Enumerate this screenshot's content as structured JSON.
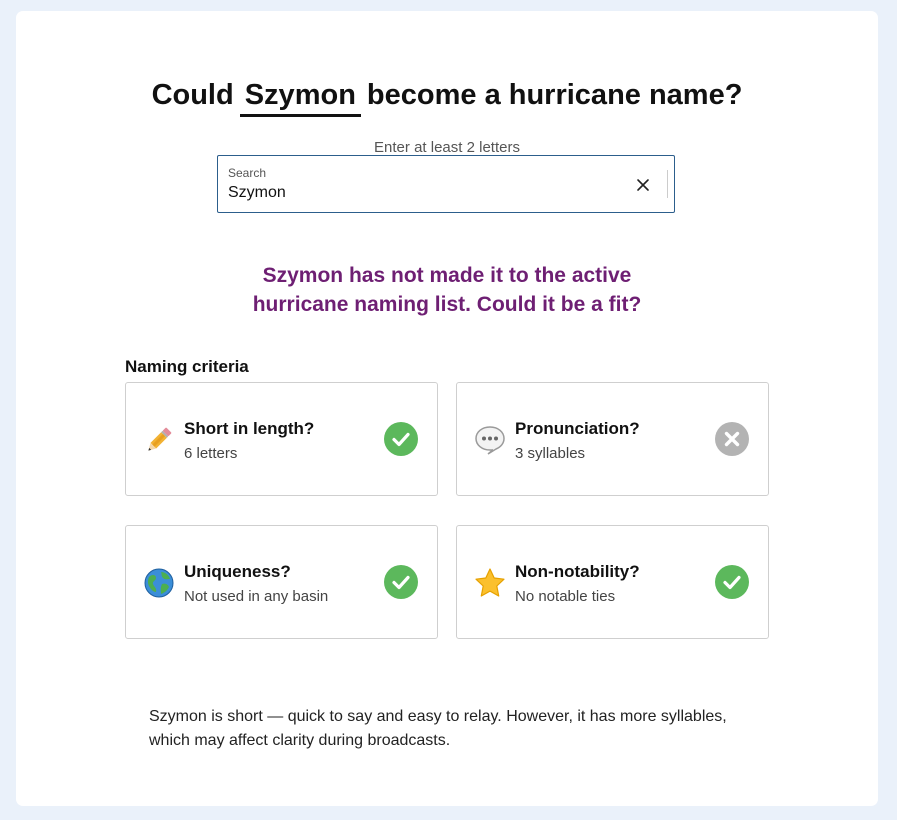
{
  "headline": {
    "prefix": "Could",
    "name": "Szymon",
    "suffix": "become a hurricane name?"
  },
  "search": {
    "hint": "Enter at least 2 letters",
    "label": "Search",
    "value": "Szymon"
  },
  "result_message": {
    "line1": "Szymon has not made it to the active",
    "line2": "hurricane naming list. Could it be a fit?"
  },
  "criteria": {
    "heading": "Naming criteria",
    "items": [
      {
        "icon": "pencil-icon",
        "title": "Short in length?",
        "detail": "6 letters",
        "status": "pass"
      },
      {
        "icon": "speech-bubble-icon",
        "title": "Pronunciation?",
        "detail": "3 syllables",
        "status": "fail"
      },
      {
        "icon": "globe-icon",
        "title": "Uniqueness?",
        "detail": "Not used in any basin",
        "status": "pass"
      },
      {
        "icon": "star-icon",
        "title": "Non-notability?",
        "detail": "No notable ties",
        "status": "pass"
      }
    ]
  },
  "summary": "Szymon is short — quick to say and easy to relay. However, it has more syllables, which may affect clarity during broadcasts.",
  "colors": {
    "result_text": "#6e1f73",
    "pass": "#5cb85c",
    "fail": "#b3b3b3",
    "input_border": "#2c5e8c",
    "page_background": "#eaf1fa"
  }
}
